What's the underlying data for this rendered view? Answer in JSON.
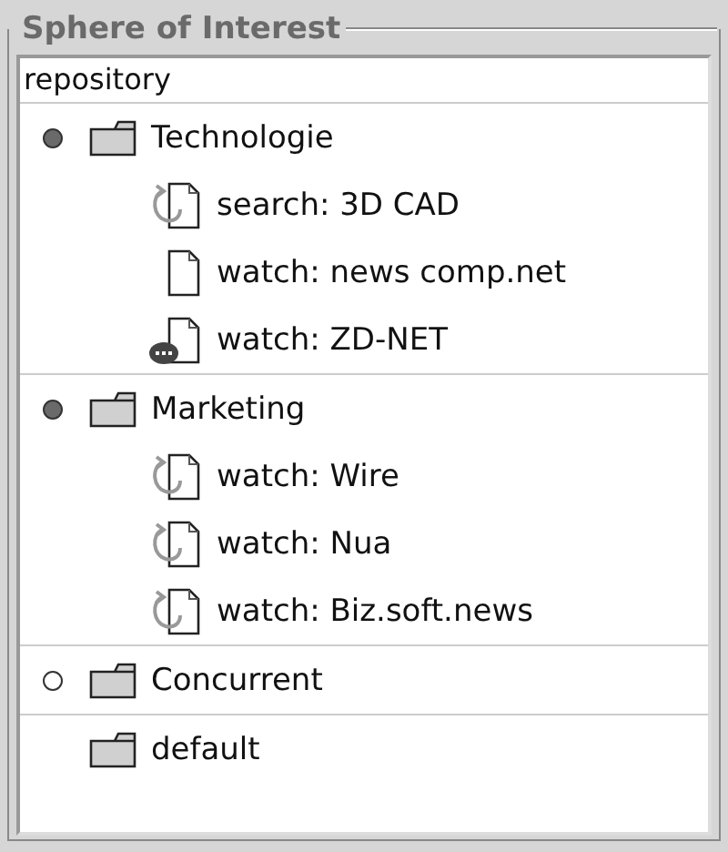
{
  "group": {
    "title": "Sphere of Interest"
  },
  "tree": {
    "root": "repository",
    "folders": [
      {
        "label": "Technologie",
        "marked": true,
        "active": true,
        "children": [
          {
            "label": "search: 3D CAD",
            "kind": "refresh"
          },
          {
            "label": "watch: news comp.net",
            "kind": "doc"
          },
          {
            "label": "watch: ZD-NET",
            "kind": "chat"
          }
        ]
      },
      {
        "label": "Marketing",
        "marked": true,
        "active": true,
        "children": [
          {
            "label": "watch: Wire",
            "kind": "refresh"
          },
          {
            "label": "watch: Nua",
            "kind": "refresh"
          },
          {
            "label": "watch: Biz.soft.news",
            "kind": "refresh"
          }
        ]
      },
      {
        "label": "Concurrent",
        "marked": true,
        "active": false
      },
      {
        "label": "default",
        "marked": false
      }
    ]
  }
}
